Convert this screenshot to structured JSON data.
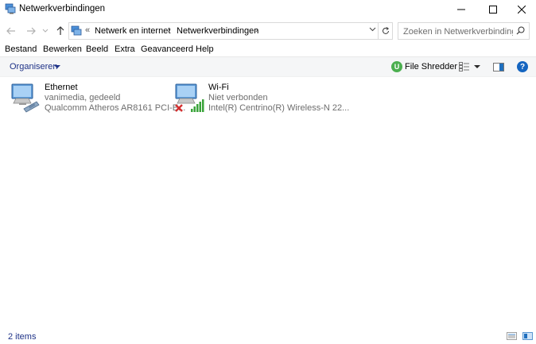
{
  "window": {
    "title": "Netwerkverbindingen",
    "icon": "network-connections-icon",
    "controls": [
      "minimize-icon",
      "maximize-icon",
      "close-icon"
    ]
  },
  "navigation": {
    "back_icon": "back-arrow-icon",
    "forward_icon": "forward-arrow-icon",
    "up_icon": "up-arrow-icon",
    "address": {
      "overflow": "«",
      "breadcrumbs": [
        "Netwerk en internet",
        "Netwerkverbindingen"
      ],
      "separator": "›"
    },
    "refresh_icon": "refresh-icon",
    "search": {
      "placeholder": "Zoeken in Netwerkverbinding...",
      "value": ""
    }
  },
  "menu": {
    "items": [
      "Bestand",
      "Bewerken",
      "Beeld",
      "Extra",
      "Geavanceerd",
      "Help"
    ]
  },
  "commandbar": {
    "organise": "Organiseren",
    "file_shredder": "File Shredder"
  },
  "connections": [
    {
      "name": "Ethernet",
      "status": "vanimedia, gedeeld",
      "device": "Qualcomm Atheros AR8161 PCI-E...",
      "icon": "ethernet-adapter-icon"
    },
    {
      "name": "Wi-Fi",
      "status": "Niet verbonden",
      "device": "Intel(R) Centrino(R) Wireless-N 22...",
      "icon": "wifi-adapter-icon"
    }
  ],
  "statusbar": {
    "count": "2 items"
  },
  "colors": {
    "link_blue": "#1e3287",
    "help_blue": "#1565c0",
    "shredder_green": "#4caf50",
    "signal_green": "#3aa33a",
    "disconnected_red": "#d32f2f",
    "gray_text": "#6d6d6d"
  }
}
